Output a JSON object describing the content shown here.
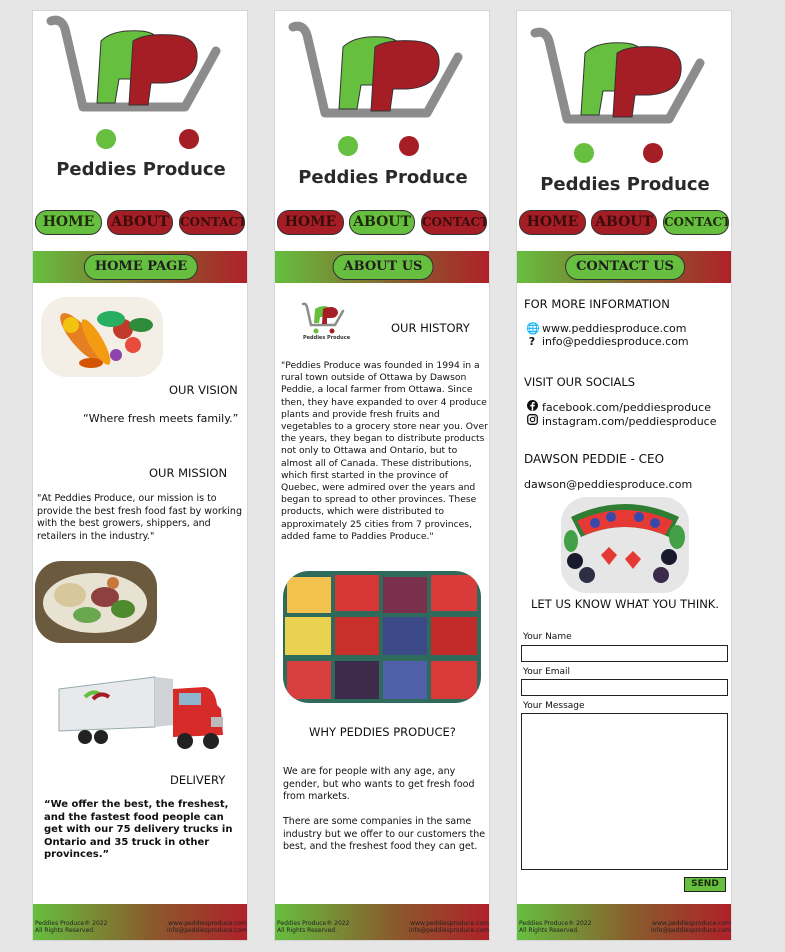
{
  "brand": {
    "name": "Peddies Produce"
  },
  "nav": {
    "home": "HOME",
    "about": "ABOUT",
    "contact": "CONTACT"
  },
  "pages": {
    "home": {
      "banner": "HOME PAGE",
      "vision_heading": "OUR VISION",
      "vision_text": "“Where fresh meets family.”",
      "mission_heading": "OUR MISSION",
      "mission_text": "\"At Peddies Produce, our mission is to provide the best fresh food fast by working with the best growers, shippers, and retailers in the industry.\"",
      "delivery_heading": "DELIVERY",
      "delivery_text": "“We offer the best, the freshest, and the fastest food people can get with our 75 delivery trucks in Ontario and 35 truck in other provinces.”"
    },
    "about": {
      "banner": "ABOUT US",
      "history_heading": "OUR HISTORY",
      "history_text": "\"Peddies Produce was founded in 1994 in a rural town outside of Ottawa by Dawson Peddie, a local farmer from Ottawa. Since then, they have expanded to over 4 produce plants and provide fresh fruits and vegetables to a grocery store near you. Over the years, they began to distribute products not only to Ottawa and Ontario, but to almost all of Canada. These distributions, which first started in the province of Quebec, were admired over the years and began to spread to other provinces. These products, which were distributed to approximately 25 cities from 7 provinces, added fame to Paddies Produce.\"",
      "why_heading": "WHY PEDDIES PRODUCE?",
      "why_p1": "We are for people with any age, any gender, but who wants to get fresh food from markets.",
      "why_p2": "There are some companies in the same industry but we offer to our customers the best, and the freshest food they can get."
    },
    "contact": {
      "banner": "CONTACT US",
      "more_info_heading": "FOR MORE INFORMATION",
      "website": "www.peddiesproduce.com",
      "email": "info@peddiesproduce.com",
      "socials_heading": "VISIT OUR SOCIALS",
      "facebook": "facebook.com/peddiesproduce",
      "instagram": "instagram.com/peddiesproduce",
      "ceo_heading": "DAWSON PEDDIE - CEO",
      "ceo_email": "dawson@peddiesproduce.com",
      "feedback_heading": "LET US KNOW WHAT YOU THINK.",
      "form": {
        "name_label": "Your Name",
        "email_label": "Your Email",
        "message_label": "Your Message",
        "send_label": "SEND"
      }
    }
  },
  "footer": {
    "copyright": "Peddies Produce® 2022",
    "rights": "All Rights Reserved.",
    "site": "www.peddiesproduce.com",
    "mail": "info@peddiesproduce.com"
  },
  "icons": [
    "globe-icon",
    "question-icon",
    "facebook-icon",
    "instagram-icon",
    "cart-logo-icon"
  ],
  "colors": {
    "brand_green": "#66bf3f",
    "brand_red": "#a51d25",
    "cart_gray": "#8c8c8c"
  }
}
